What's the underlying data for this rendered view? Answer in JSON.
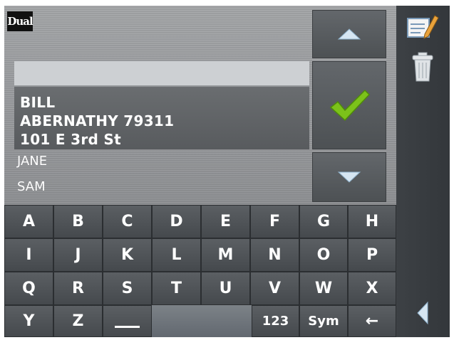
{
  "logo_text": "Dual",
  "search": {
    "value": ""
  },
  "selected_entry": {
    "lines": [
      "BILL",
      "ABERNATHY 79311",
      "101 E 3rd St"
    ]
  },
  "list_items": [
    "JANE",
    "SAM"
  ],
  "nav": {
    "up_icon": "up-arrow-icon",
    "confirm_icon": "checkmark-icon",
    "down_icon": "down-arrow-icon"
  },
  "sidebar": {
    "edit_icon": "edit-notes-icon",
    "delete_icon": "trash-icon",
    "back_icon": "back-arrow-icon"
  },
  "keyboard": {
    "rows": [
      [
        "A",
        "B",
        "C",
        "D",
        "E",
        "F",
        "G",
        "H"
      ],
      [
        "I",
        "J",
        "K",
        "L",
        "M",
        "N",
        "O",
        "P"
      ],
      [
        "Q",
        "R",
        "S",
        "T",
        "U",
        "V",
        "W",
        "X"
      ]
    ],
    "bottom_left": [
      "Y",
      "Z"
    ],
    "space_label": "space",
    "num_label": "123",
    "sym_label": "Sym",
    "backspace_label": "←"
  },
  "colors": {
    "accent_check": "#7cc21a",
    "panel": "#9c9ea1",
    "key": "#52565a"
  }
}
